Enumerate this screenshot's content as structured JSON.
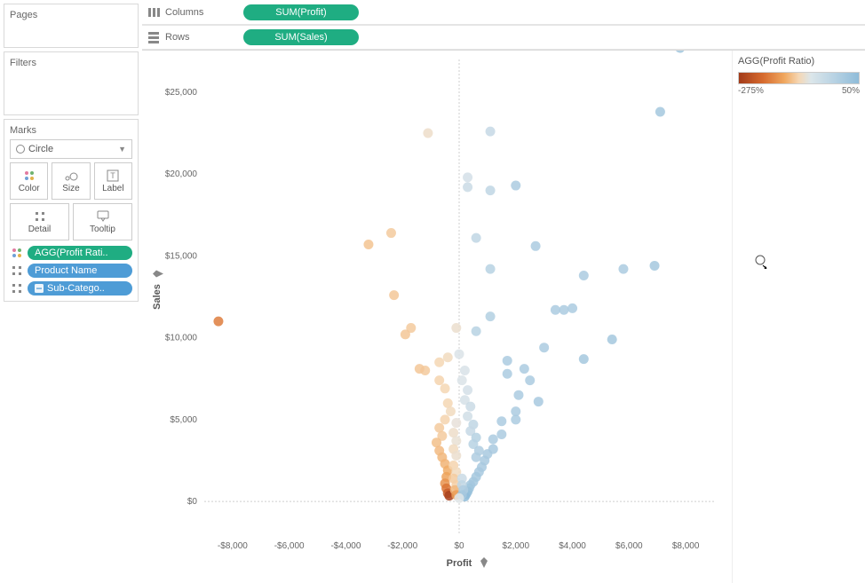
{
  "panels": {
    "pages_title": "Pages",
    "filters_title": "Filters",
    "marks_title": "Marks"
  },
  "marks": {
    "type": "Circle",
    "cards": {
      "color": "Color",
      "size": "Size",
      "label": "Label",
      "detail": "Detail",
      "tooltip": "Tooltip"
    },
    "pills": {
      "color_pill": "AGG(Profit Rati..",
      "detail_pill": "Product Name",
      "detail_pill2": "Sub-Catego..",
      "pill2_box_prefix": "−"
    }
  },
  "shelves": {
    "columns_label": "Columns",
    "rows_label": "Rows",
    "columns_pill": "SUM(Profit)",
    "rows_pill": "SUM(Sales)"
  },
  "legend": {
    "title": "AGG(Profit Ratio)",
    "min": "-275%",
    "max": "50%"
  },
  "chart_data": {
    "type": "scatter",
    "xlabel": "Profit",
    "ylabel": "Sales",
    "xlim": [
      -9000,
      9000
    ],
    "ylim": [
      -2000,
      27000
    ],
    "x_ticks": [
      -8000,
      -6000,
      -4000,
      -2000,
      0,
      2000,
      4000,
      6000,
      8000
    ],
    "x_tick_labels": [
      "-$8,000",
      "-$6,000",
      "-$4,000",
      "-$2,000",
      "$0",
      "$2,000",
      "$4,000",
      "$6,000",
      "$8,000"
    ],
    "y_ticks": [
      0,
      5000,
      10000,
      15000,
      20000,
      25000
    ],
    "y_tick_labels": [
      "$0",
      "$5,000",
      "$10,000",
      "$15,000",
      "$20,000",
      "$25,000"
    ],
    "color_field": "AGG(Profit Ratio)",
    "color_range_pct": [
      -275,
      50
    ],
    "points": [
      {
        "x": 7800,
        "y": 27700,
        "r": 35
      },
      {
        "x": 7100,
        "y": 23800,
        "r": 30
      },
      {
        "x": 6900,
        "y": 14400,
        "r": 30
      },
      {
        "x": 5800,
        "y": 14200,
        "r": 25
      },
      {
        "x": 4400,
        "y": 13800,
        "r": 25
      },
      {
        "x": 4000,
        "y": 11800,
        "r": 25
      },
      {
        "x": 3700,
        "y": 11700,
        "r": 25
      },
      {
        "x": 3400,
        "y": 11700,
        "r": 25
      },
      {
        "x": 3000,
        "y": 9400,
        "r": 25
      },
      {
        "x": 4400,
        "y": 8700,
        "r": 30
      },
      {
        "x": 5400,
        "y": 9900,
        "r": 30
      },
      {
        "x": 2000,
        "y": 19300,
        "r": 25
      },
      {
        "x": 2700,
        "y": 15600,
        "r": 25
      },
      {
        "x": 1100,
        "y": 22600,
        "r": 10
      },
      {
        "x": 1100,
        "y": 19000,
        "r": 12
      },
      {
        "x": 300,
        "y": 19200,
        "r": 8
      },
      {
        "x": 300,
        "y": 19800,
        "r": 5
      },
      {
        "x": 600,
        "y": 16100,
        "r": 12
      },
      {
        "x": 1100,
        "y": 14200,
        "r": 15
      },
      {
        "x": 1100,
        "y": 11300,
        "r": 18
      },
      {
        "x": 600,
        "y": 10400,
        "r": 15
      },
      {
        "x": 1700,
        "y": 7800,
        "r": 25
      },
      {
        "x": 1700,
        "y": 8600,
        "r": 25
      },
      {
        "x": 2300,
        "y": 8100,
        "r": 25
      },
      {
        "x": 2500,
        "y": 7400,
        "r": 25
      },
      {
        "x": 2100,
        "y": 6500,
        "r": 25
      },
      {
        "x": 2800,
        "y": 6100,
        "r": 28
      },
      {
        "x": 2000,
        "y": 5500,
        "r": 25
      },
      {
        "x": 2000,
        "y": 5000,
        "r": 25
      },
      {
        "x": 1500,
        "y": 4900,
        "r": 25
      },
      {
        "x": 1500,
        "y": 4100,
        "r": 25
      },
      {
        "x": 1200,
        "y": 3800,
        "r": 25
      },
      {
        "x": 1200,
        "y": 3200,
        "r": 28
      },
      {
        "x": 1000,
        "y": 2900,
        "r": 28
      },
      {
        "x": 900,
        "y": 2500,
        "r": 28
      },
      {
        "x": 800,
        "y": 2100,
        "r": 28
      },
      {
        "x": 700,
        "y": 1800,
        "r": 28
      },
      {
        "x": 600,
        "y": 1500,
        "r": 30
      },
      {
        "x": 500,
        "y": 1200,
        "r": 30
      },
      {
        "x": 400,
        "y": 1000,
        "r": 32
      },
      {
        "x": 350,
        "y": 800,
        "r": 35
      },
      {
        "x": 300,
        "y": 600,
        "r": 40
      },
      {
        "x": 250,
        "y": 450,
        "r": 45
      },
      {
        "x": 200,
        "y": 300,
        "r": 50
      },
      {
        "x": -100,
        "y": 10600,
        "r": -5
      },
      {
        "x": -400,
        "y": 8800,
        "r": -8
      },
      {
        "x": -700,
        "y": 8500,
        "r": -10
      },
      {
        "x": -700,
        "y": 7400,
        "r": -12
      },
      {
        "x": -500,
        "y": 6900,
        "r": -10
      },
      {
        "x": -400,
        "y": 6000,
        "r": -10
      },
      {
        "x": -300,
        "y": 5500,
        "r": -8
      },
      {
        "x": -500,
        "y": 5000,
        "r": -12
      },
      {
        "x": -700,
        "y": 4500,
        "r": -18
      },
      {
        "x": -600,
        "y": 4000,
        "r": -18
      },
      {
        "x": -800,
        "y": 3600,
        "r": -25
      },
      {
        "x": -700,
        "y": 3100,
        "r": -28
      },
      {
        "x": -600,
        "y": 2700,
        "r": -30
      },
      {
        "x": -500,
        "y": 2300,
        "r": -32
      },
      {
        "x": -400,
        "y": 1900,
        "r": -38
      },
      {
        "x": -450,
        "y": 1500,
        "r": -45
      },
      {
        "x": -500,
        "y": 1100,
        "r": -60
      },
      {
        "x": -450,
        "y": 800,
        "r": -90
      },
      {
        "x": -400,
        "y": 500,
        "r": -150
      },
      {
        "x": -350,
        "y": 350,
        "r": -250
      },
      {
        "x": -1200,
        "y": 8000,
        "r": -18
      },
      {
        "x": -1400,
        "y": 8100,
        "r": -20
      },
      {
        "x": -1700,
        "y": 10600,
        "r": -18
      },
      {
        "x": -1900,
        "y": 10200,
        "r": -20
      },
      {
        "x": -2400,
        "y": 16400,
        "r": -18
      },
      {
        "x": -2300,
        "y": 12600,
        "r": -20
      },
      {
        "x": -3200,
        "y": 15700,
        "r": -22
      },
      {
        "x": -1100,
        "y": 22500,
        "r": -6
      },
      {
        "x": -8500,
        "y": 11000,
        "r": -80
      },
      {
        "x": 0,
        "y": 9000,
        "r": 2
      },
      {
        "x": 200,
        "y": 8000,
        "r": 3
      },
      {
        "x": 100,
        "y": 7400,
        "r": 2
      },
      {
        "x": 300,
        "y": 6800,
        "r": 5
      },
      {
        "x": 200,
        "y": 6200,
        "r": 4
      },
      {
        "x": 400,
        "y": 5800,
        "r": 8
      },
      {
        "x": 300,
        "y": 5200,
        "r": 6
      },
      {
        "x": 500,
        "y": 4700,
        "r": 12
      },
      {
        "x": 400,
        "y": 4300,
        "r": 10
      },
      {
        "x": 600,
        "y": 3900,
        "r": 16
      },
      {
        "x": 500,
        "y": 3500,
        "r": 15
      },
      {
        "x": 700,
        "y": 3100,
        "r": 22
      },
      {
        "x": 600,
        "y": 2700,
        "r": 22
      },
      {
        "x": -100,
        "y": 4800,
        "r": -3
      },
      {
        "x": -200,
        "y": 4200,
        "r": -6
      },
      {
        "x": -100,
        "y": 3700,
        "r": -4
      },
      {
        "x": -200,
        "y": 3200,
        "r": -8
      },
      {
        "x": -100,
        "y": 2800,
        "r": -5
      },
      {
        "x": -200,
        "y": 2200,
        "r": -12
      },
      {
        "x": -100,
        "y": 1800,
        "r": -8
      },
      {
        "x": -200,
        "y": 1400,
        "r": -18
      },
      {
        "x": -100,
        "y": 1000,
        "r": -15
      },
      {
        "x": -150,
        "y": 700,
        "r": -30
      },
      {
        "x": -100,
        "y": 400,
        "r": -50
      },
      {
        "x": 100,
        "y": 1400,
        "r": 8
      },
      {
        "x": 100,
        "y": 1000,
        "r": 12
      },
      {
        "x": 150,
        "y": 700,
        "r": 22
      },
      {
        "x": 100,
        "y": 400,
        "r": 30
      },
      {
        "x": 0,
        "y": 200,
        "r": 0
      }
    ]
  }
}
